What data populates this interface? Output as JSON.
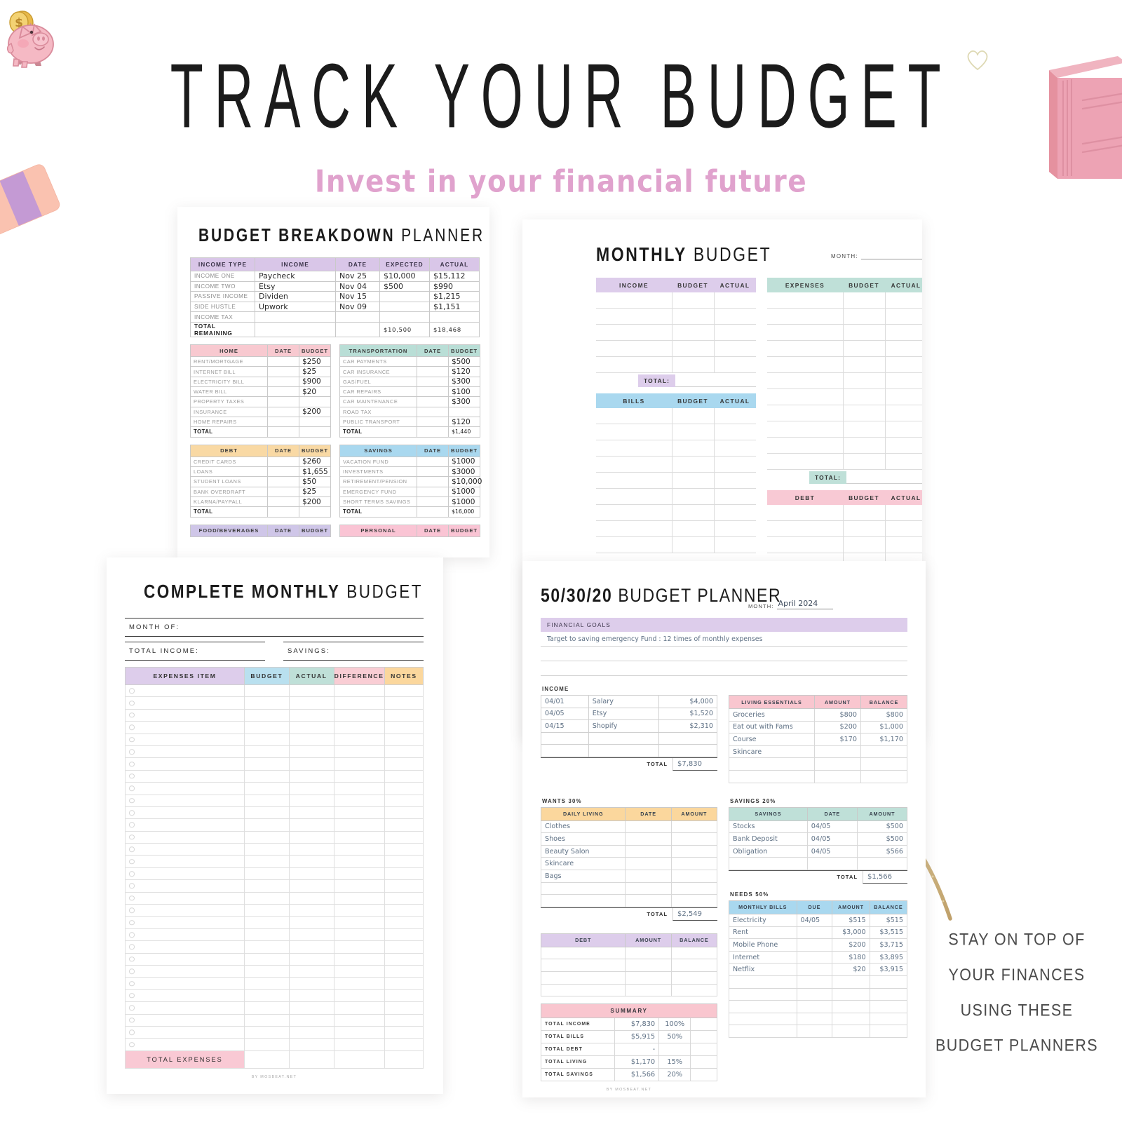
{
  "header": {
    "title": "TRACK YOUR BUDGET",
    "subtitle": "Invest in your financial future"
  },
  "cta": {
    "lines": [
      "STAY ON TOP OF",
      "YOUR FINANCES",
      "USING THESE",
      "BUDGET PLANNERS"
    ]
  },
  "decorations": {
    "piggy_bank": "piggy-bank-icon",
    "notebook": "pink-notebook-icon",
    "eraser": "eraser-icon",
    "heart": "heart-outline-icon",
    "arrow": "gold-glitter-arrow-icon",
    "colors": {
      "piggy_pink": "#f5b9c4",
      "coin_gold": "#f2cf62",
      "notebook_pink": "#eda3b4",
      "eraser_peach": "#fac2b0",
      "eraser_band": "#c49ad4",
      "arrow_gold": "#c9ab72"
    }
  },
  "budget_breakdown": {
    "title_bold": "BUDGET BREAKDOWN",
    "title_thin": "PLANNER",
    "income_table": {
      "headers": [
        "INCOME TYPE",
        "INCOME",
        "DATE",
        "EXPECTED",
        "ACTUAL"
      ],
      "rows": [
        [
          "INCOME ONE",
          "Paycheck",
          "Nov 25",
          "$10,000",
          "$15,112"
        ],
        [
          "INCOME TWO",
          "Etsy",
          "Nov 04",
          "$500",
          "$990"
        ],
        [
          "PASSIVE INCOME",
          "Dividen",
          "Nov 15",
          "",
          "$1,215"
        ],
        [
          "SIDE HUSTLE",
          "Upwork",
          "Nov 09",
          "",
          "$1,151"
        ],
        [
          "INCOME TAX",
          "",
          "",
          "",
          ""
        ]
      ],
      "total_row": [
        "TOTAL REMAINING",
        "",
        "",
        "$10,500",
        "$18,468"
      ]
    },
    "home": {
      "headers": [
        "HOME",
        "DATE",
        "BUDGET"
      ],
      "rows": [
        [
          "RENT/MORTGAGE",
          "",
          "$250"
        ],
        [
          "INTERNET BILL",
          "",
          "$25"
        ],
        [
          "ELECTRICITY BILL",
          "",
          "$900"
        ],
        [
          "WATER BILL",
          "",
          "$20"
        ],
        [
          "PROPERTY TAXES",
          "",
          ""
        ],
        [
          "INSURANCE",
          "",
          "$200"
        ],
        [
          "HOME REPAIRS",
          "",
          ""
        ]
      ],
      "total": [
        "TOTAL",
        "",
        ""
      ]
    },
    "transportation": {
      "headers": [
        "TRANSPORTATION",
        "DATE",
        "BUDGET"
      ],
      "rows": [
        [
          "CAR PAYMENTS",
          "",
          "$500"
        ],
        [
          "CAR INSURANCE",
          "",
          "$120"
        ],
        [
          "GAS/FUEL",
          "",
          "$300"
        ],
        [
          "CAR REPAIRS",
          "",
          "$100"
        ],
        [
          "CAR MAINTENANCE",
          "",
          "$300"
        ],
        [
          "ROAD TAX",
          "",
          ""
        ],
        [
          "PUBLIC TRANSPORT",
          "",
          "$120"
        ]
      ],
      "total": [
        "TOTAL",
        "",
        "$1,440"
      ]
    },
    "debt": {
      "headers": [
        "DEBT",
        "DATE",
        "BUDGET"
      ],
      "rows": [
        [
          "CREDIT CARDS",
          "",
          "$260"
        ],
        [
          "LOANS",
          "",
          "$1,655"
        ],
        [
          "STUDENT LOANS",
          "",
          "$50"
        ],
        [
          "BANK OVERDRAFT",
          "",
          "$25"
        ],
        [
          "KLARNA/PAYPALL",
          "",
          "$200"
        ]
      ],
      "total": [
        "TOTAL",
        "",
        ""
      ]
    },
    "savings": {
      "headers": [
        "SAVINGS",
        "DATE",
        "BUDGET"
      ],
      "rows": [
        [
          "VACATION FUND",
          "",
          "$1000"
        ],
        [
          "INVESTMENTS",
          "",
          "$3000"
        ],
        [
          "RETIREMENT/PENSION",
          "",
          "$10,000"
        ],
        [
          "EMERGENCY FUND",
          "",
          "$1000"
        ],
        [
          "SHORT TERMS SAVINGS",
          "",
          "$1000"
        ]
      ],
      "total": [
        "TOTAL",
        "",
        "$16,000"
      ]
    },
    "food": {
      "headers": [
        "FOOD/BEVERAGES",
        "DATE",
        "BUDGET"
      ]
    },
    "personal": {
      "headers": [
        "PERSONAL",
        "DATE",
        "BUDGET"
      ]
    }
  },
  "monthly_budget": {
    "title_bold": "MONTHLY",
    "title_thin": "BUDGET",
    "month_label": "MONTH:",
    "month_value": "",
    "income": {
      "headers": [
        "INCOME",
        "BUDGET",
        "ACTUAL"
      ],
      "row_count": 5,
      "total_label": "TOTAL:"
    },
    "bills": {
      "headers": [
        "BILLS",
        "BUDGET",
        "ACTUAL"
      ],
      "row_count": 9
    },
    "expenses": {
      "headers": [
        "EXPENSES",
        "BUDGET",
        "ACTUAL"
      ],
      "row_count": 11,
      "total_label": "TOTAL:"
    },
    "debt": {
      "headers": [
        "DEBT",
        "BUDGET",
        "ACTUAL"
      ],
      "row_count": 4
    }
  },
  "complete_monthly": {
    "title_bold": "COMPLETE MONTHLY",
    "title_thin": "BUDGET",
    "month_of": "MONTH OF:",
    "total_income": "TOTAL INCOME:",
    "savings": "SAVINGS:",
    "headers": [
      "EXPENSES ITEM",
      "BUDGET",
      "ACTUAL",
      "DIFFERENCE",
      "NOTES"
    ],
    "row_count": 30,
    "total_label": "TOTAL EXPENSES",
    "credit": "BY  MOSBEAT.NET"
  },
  "planner_503020": {
    "title_bold": "50/30/20",
    "title_thin": "BUDGET PLANNER",
    "month_label": "MONTH:",
    "month_value": "April 2024",
    "goals_header": "FINANCIAL GOALS",
    "goal_text": "Target to saving emergency Fund : 12 times of monthly expenses",
    "income_label": "INCOME",
    "income_rows": [
      [
        "04/01",
        "Salary",
        "$4,000"
      ],
      [
        "04/05",
        "Etsy",
        "$1,520"
      ],
      [
        "04/15",
        "Shopify",
        "$2,310"
      ],
      [
        "",
        "",
        ""
      ],
      [
        "",
        "",
        ""
      ]
    ],
    "income_total_label": "TOTAL",
    "income_total": "$7,830",
    "living_essentials": {
      "headers": [
        "LIVING ESSENTIALS",
        "AMOUNT",
        "BALANCE"
      ],
      "rows": [
        [
          "Groceries",
          "$800",
          "$800"
        ],
        [
          "Eat out with Fams",
          "$200",
          "$1,000"
        ],
        [
          "Course",
          "$170",
          "$1,170"
        ],
        [
          "Skincare",
          "",
          ""
        ],
        [
          "",
          "",
          ""
        ],
        [
          "",
          "",
          ""
        ]
      ]
    },
    "wants_label": "WANTS 30%",
    "daily_living": {
      "headers": [
        "DAILY LIVING",
        "DATE",
        "AMOUNT"
      ],
      "rows": [
        [
          "Clothes",
          "",
          ""
        ],
        [
          "Shoes",
          "",
          ""
        ],
        [
          "Beauty Salon",
          "",
          ""
        ],
        [
          "Skincare",
          "",
          ""
        ],
        [
          "Bags",
          "",
          ""
        ],
        [
          "",
          "",
          ""
        ],
        [
          "",
          "",
          ""
        ]
      ],
      "total_label": "TOTAL",
      "total": "$2,549"
    },
    "savings_label": "SAVINGS 20%",
    "savings_table": {
      "headers": [
        "SAVINGS",
        "DATE",
        "AMOUNT"
      ],
      "rows": [
        [
          "Stocks",
          "04/05",
          "$500"
        ],
        [
          "Bank Deposit",
          "04/05",
          "$500"
        ],
        [
          "Obligation",
          "04/05",
          "$566"
        ],
        [
          "",
          "",
          ""
        ]
      ],
      "total_label": "TOTAL",
      "total": "$1,566"
    },
    "needs_label": "NEEDS 50%",
    "monthly_bills": {
      "headers": [
        "MONTHLY BILLS",
        "DUE",
        "AMOUNT",
        "BALANCE"
      ],
      "rows": [
        [
          "Electricity",
          "04/05",
          "$515",
          "$515"
        ],
        [
          "Rent",
          "",
          "$3,000",
          "$3,515"
        ],
        [
          "Mobile Phone",
          "",
          "$200",
          "$3,715"
        ],
        [
          "Internet",
          "",
          "$180",
          "$3,895"
        ],
        [
          "Netflix",
          "",
          "$20",
          "$3,915"
        ],
        [
          "",
          "",
          "",
          ""
        ],
        [
          "",
          "",
          "",
          ""
        ],
        [
          "",
          "",
          "",
          ""
        ],
        [
          "",
          "",
          "",
          ""
        ],
        [
          "",
          "",
          "",
          ""
        ]
      ]
    },
    "debt_table": {
      "headers": [
        "DEBT",
        "AMOUNT",
        "BALANCE"
      ],
      "rows": [
        [
          "",
          "",
          ""
        ],
        [
          "",
          "",
          ""
        ],
        [
          "",
          "",
          ""
        ],
        [
          "",
          "",
          ""
        ]
      ]
    },
    "summary": {
      "header": "SUMMARY",
      "rows": [
        [
          "TOTAL INCOME",
          "$7,830",
          "100%"
        ],
        [
          "TOTAL BILLS",
          "$5,915",
          "50%"
        ],
        [
          "TOTAL DEBT",
          "-",
          ""
        ],
        [
          "TOTAL LIVING",
          "$1,170",
          "15%"
        ],
        [
          "TOTAL SAVINGS",
          "$1,566",
          "20%"
        ]
      ]
    },
    "credit": "BY  MOSBEAT.NET"
  }
}
